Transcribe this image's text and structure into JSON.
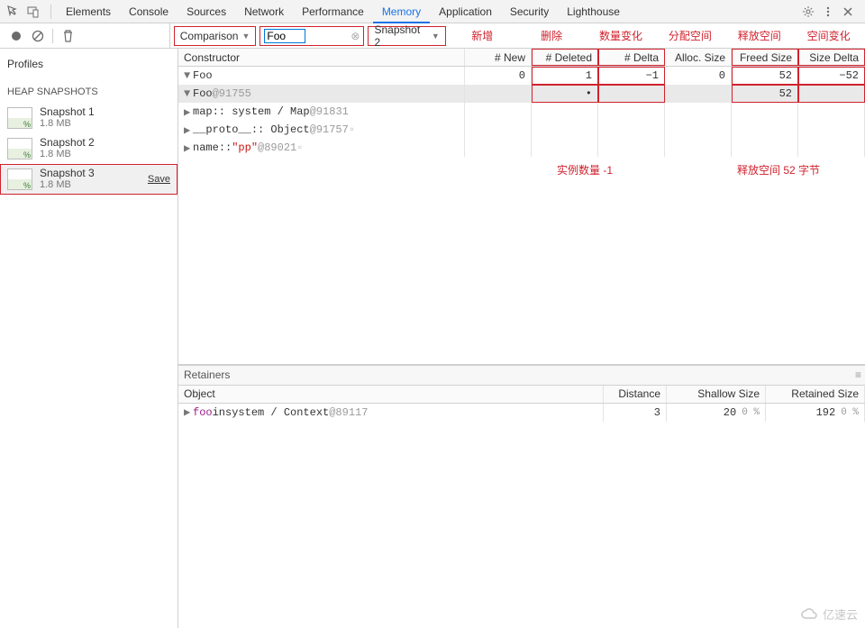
{
  "tabs": {
    "items": [
      "Elements",
      "Console",
      "Sources",
      "Network",
      "Performance",
      "Memory",
      "Application",
      "Security",
      "Lighthouse"
    ],
    "active": "Memory"
  },
  "sidebar": {
    "title": "Profiles",
    "group": "HEAP SNAPSHOTS",
    "snapshots": [
      {
        "name": "Snapshot 1",
        "size": "1.8 MB"
      },
      {
        "name": "Snapshot 2",
        "size": "1.8 MB"
      },
      {
        "name": "Snapshot 3",
        "size": "1.8 MB"
      }
    ],
    "save_label": "Save",
    "selected_index": 2
  },
  "toolbar": {
    "view_mode": "Comparison",
    "filter_value": "Foo",
    "baseline": "Snapshot 2"
  },
  "annotations": {
    "cols": [
      "新增",
      "删除",
      "数量变化",
      "分配空间",
      "释放空间",
      "空间变化"
    ],
    "note1": "实例数量 -1",
    "note2": "释放空间 52 字节"
  },
  "table": {
    "headers": [
      "Constructor",
      "# New",
      "# Deleted",
      "# Delta",
      "Alloc. Size",
      "Freed Size",
      "Size Delta"
    ],
    "rows": [
      {
        "label": "Foo",
        "level": 0,
        "expanded": true,
        "vals": [
          "0",
          "1",
          "−1",
          "0",
          "52",
          "−52"
        ]
      },
      {
        "label": "Foo ",
        "idref": "@91755",
        "level": 1,
        "expanded": true,
        "selected": true,
        "vals": [
          "",
          "•",
          "",
          "",
          "52",
          ""
        ]
      },
      {
        "label": "map ",
        "suffix": ":: system / Map ",
        "idref": "@91831",
        "level": 2
      },
      {
        "label": "__proto__ ",
        "suffix": ":: Object ",
        "idref": "@91757",
        "trailing_icon": true,
        "level": 2
      },
      {
        "label": "name ",
        "suffix": ":: ",
        "string": "\"pp\"",
        "idref": " @89021",
        "trailing_icon": true,
        "level": 2
      }
    ]
  },
  "retainers": {
    "title": "Retainers",
    "headers": [
      "Object",
      "Distance",
      "Shallow Size",
      "Retained Size"
    ],
    "row": {
      "prop": "foo",
      "mid": " in ",
      "ctx": "system / Context ",
      "idref": "@89117",
      "distance": "3",
      "shallow": "20",
      "shallow_pct": "0 %",
      "retained": "192",
      "retained_pct": "0 %"
    }
  },
  "watermark": "亿速云"
}
